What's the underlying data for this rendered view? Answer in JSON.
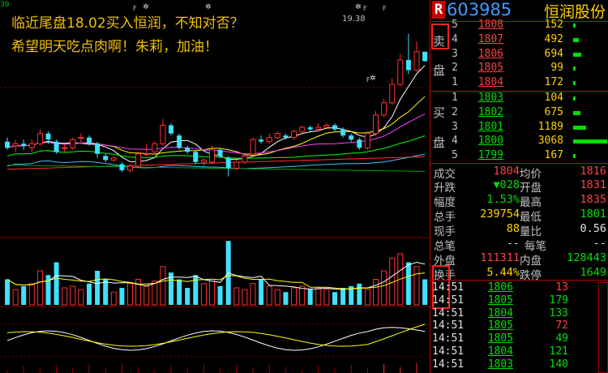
{
  "overlay": {
    "line1": "临近尾盘18.02买入恒润，不知对否？",
    "line2": "希望明天吃点肉啊！朱莉，加油！"
  },
  "chart": {
    "price_label": "19.38",
    "corner_label": "39",
    "markers": [
      "F",
      "F",
      "F",
      "F"
    ],
    "colors": {
      "up": "#ff3030",
      "down": "#40e0ff",
      "ma5": "#ffffff",
      "ma10": "#ffff00",
      "ma20": "#ff40ff",
      "ma30": "#00ff00",
      "ma60": "#40c0ff",
      "ma120": "#ff3030"
    },
    "candles": [
      {
        "o": 0,
        "c": 0
      }
    ]
  },
  "header": {
    "badge": "R",
    "code": "603985",
    "name": "恒润股份"
  },
  "sell_label": "卖盘",
  "buy_label": "买盘",
  "sell": [
    {
      "lvl": "5",
      "price": "1808",
      "vol": "152",
      "dir": "up"
    },
    {
      "lvl": "4",
      "price": "1807",
      "vol": "492",
      "dir": "up"
    },
    {
      "lvl": "3",
      "price": "1806",
      "vol": "694",
      "dir": "up"
    },
    {
      "lvl": "2",
      "price": "1805",
      "vol": "99",
      "dir": "up"
    },
    {
      "lvl": "1",
      "price": "1804",
      "vol": "172",
      "dir": "up"
    }
  ],
  "buy": [
    {
      "lvl": "1",
      "price": "1803",
      "vol": "104",
      "dir": "down"
    },
    {
      "lvl": "2",
      "price": "1802",
      "vol": "675",
      "dir": "down"
    },
    {
      "lvl": "3",
      "price": "1801",
      "vol": "1189",
      "dir": "down"
    },
    {
      "lvl": "4",
      "price": "1800",
      "vol": "3068",
      "dir": "down"
    },
    {
      "lvl": "5",
      "price": "1799",
      "vol": "167",
      "dir": "down"
    }
  ],
  "stats": {
    "chengjiao_label": "成交",
    "chengjiao": "1804",
    "junjia_label": "均价",
    "junjia": "1816",
    "shengdie_label": "升跌",
    "shengdie": "▼028",
    "kaipan_label": "开盘",
    "kaipan": "1831",
    "fudu_label": "幅度",
    "fudu": "1.53%",
    "zuigao_label": "最高",
    "zuigao": "1835",
    "zongshou_label": "总手",
    "zongshou": "239754",
    "zuidi_label": "最低",
    "zuidi": "1801",
    "xianshou_label": "现手",
    "xianshou": "88",
    "liangbi_label": "量比",
    "liangbi": "0.56",
    "zongbi_label": "总笔",
    "zongbi": "--",
    "meibi_label": "每笔",
    "meibi": "--",
    "waipan_label": "外盘",
    "waipan": "111311",
    "neipan_label": "内盘",
    "neipan": "128443",
    "huanshou_label": "换手",
    "huanshou": "5.44%",
    "dieting_label": "跌停",
    "dieting": "1649"
  },
  "ticks": [
    {
      "time": "14:51",
      "price": "1806",
      "vol": "13",
      "dir": "up"
    },
    {
      "time": "14:51",
      "price": "1805",
      "vol": "179",
      "dir": "down"
    },
    {
      "time": "14:51",
      "price": "1804",
      "vol": "133",
      "dir": "down"
    },
    {
      "time": "14:51",
      "price": "1805",
      "vol": "72",
      "dir": "up"
    },
    {
      "time": "14:51",
      "price": "1805",
      "vol": "49",
      "dir": "down"
    },
    {
      "time": "14:51",
      "price": "1804",
      "vol": "121",
      "dir": "down"
    },
    {
      "time": "14:51",
      "price": "1803",
      "vol": "140",
      "dir": "down"
    }
  ]
}
